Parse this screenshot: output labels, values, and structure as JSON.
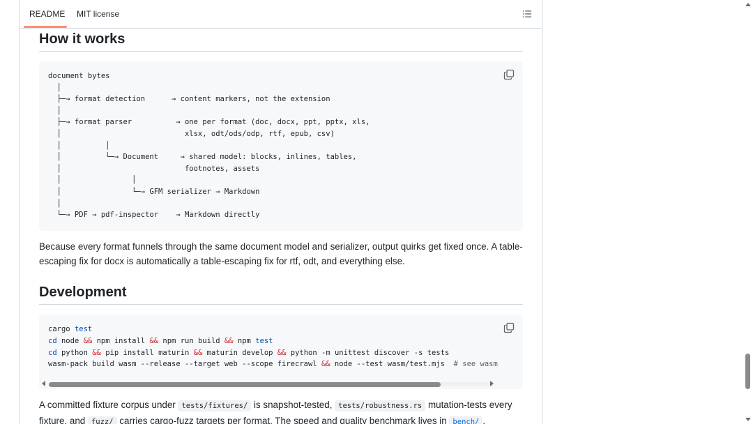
{
  "tabs": {
    "readme_label": "README",
    "license_label": "MIT license"
  },
  "how_it_works": {
    "heading": "How it works",
    "diagram_lines": [
      "document bytes",
      "  │",
      "  ├─→ format detection      → content markers, not the extension",
      "  │",
      "  ├─→ format parser          → one per format (doc, docx, ppt, pptx, xls,",
      "  │                            xlsx, odt/ods/odp, rtf, epub, csv)",
      "  │          │",
      "  │          └─→ Document     → shared model: blocks, inlines, tables,",
      "  │                            footnotes, assets",
      "  │                │",
      "  │                └─→ GFM serializer → Markdown",
      "  │",
      "  └─→ PDF → pdf-inspector    → Markdown directly"
    ],
    "paragraph": "Because every format funnels through the same document model and serializer, output quirks get fixed once. A table-escaping fix for docx is automatically a table-escaping fix for rtf, odt, and everything else."
  },
  "development": {
    "heading": "Development",
    "code": {
      "l1_cmd": "cargo ",
      "l1_kw": "test",
      "l2_a": "cd",
      "l2_b": " node ",
      "l2_op1": "&&",
      "l2_c": " npm install ",
      "l2_op2": "&&",
      "l2_d": " npm run build ",
      "l2_op3": "&&",
      "l2_e": " npm ",
      "l2_kw": "test",
      "l3_a": "cd",
      "l3_b": " python ",
      "l3_op1": "&&",
      "l3_c": " pip install maturin ",
      "l3_op2": "&&",
      "l3_d": " maturin develop ",
      "l3_op3": "&&",
      "l3_e": " python -m unittest discover -s tests",
      "l4_a": "wasm-pack build wasm --release --target web --scope firecrawl ",
      "l4_op": "&&",
      "l4_b": " node --test wasm/test.mjs  ",
      "l4_cm": "# see wasm"
    },
    "paragraph": {
      "t1": "A committed fixture corpus under ",
      "c1": "tests/fixtures/",
      "t2": " is snapshot-tested, ",
      "c2": "tests/robustness.rs",
      "t3": " mutation-tests every fixture, and ",
      "c3": "fuzz/",
      "t4": " carries cargo-fuzz targets per format. The speed and quality benchmark lives in ",
      "c4": "bench/",
      "t5": "."
    }
  },
  "colors": {
    "tab_underline": "#fd8c73",
    "keyword": "#0550ae",
    "operator": "#cf222e",
    "link": "#0969da",
    "code_bg": "#f6f8fa"
  },
  "icons": {
    "toc": "list-icon",
    "copy": "copy-icon"
  }
}
